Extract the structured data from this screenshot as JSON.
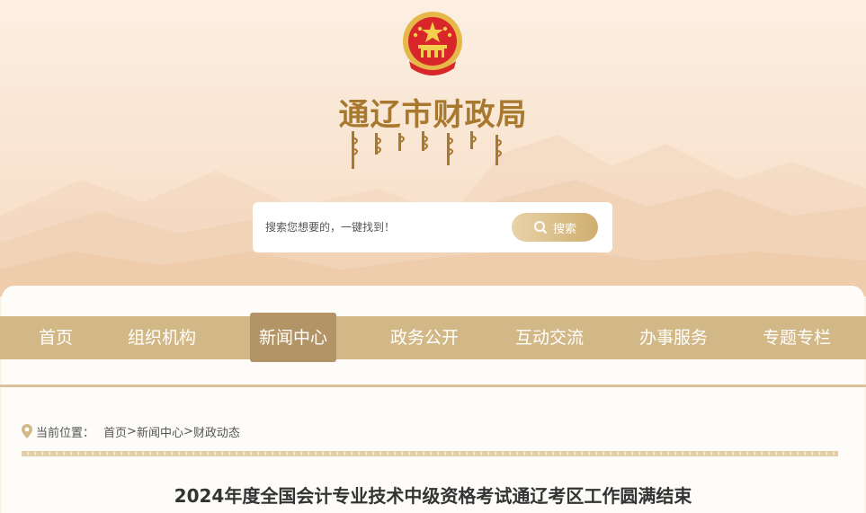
{
  "header": {
    "site_title": "通辽市财政局",
    "emblem_icon": "national-emblem-icon",
    "mongolian_title_icon": "mongolian-script-title"
  },
  "search": {
    "placeholder": "搜索您想要的，一键找到！",
    "button_label": "搜索",
    "button_icon": "search-icon"
  },
  "nav": {
    "items": [
      {
        "label": "首页"
      },
      {
        "label": "组织机构"
      },
      {
        "label": "新闻中心",
        "active": true
      },
      {
        "label": "政务公开"
      },
      {
        "label": "互动交流"
      },
      {
        "label": "办事服务"
      },
      {
        "label": "专题专栏"
      }
    ]
  },
  "breadcrumb": {
    "icon": "location-pin-icon",
    "label": "当前位置：",
    "items": [
      "首页",
      "新闻中心",
      "财政动态"
    ],
    "separator": ">"
  },
  "article": {
    "title": "2024年度全国会计专业技术中级资格考试通辽考区工作圆满结束"
  },
  "colors": {
    "brand_gold": "#a8782e",
    "nav_bg": "#d2b887",
    "nav_active": "#b39467",
    "search_button": "#cfae70"
  }
}
